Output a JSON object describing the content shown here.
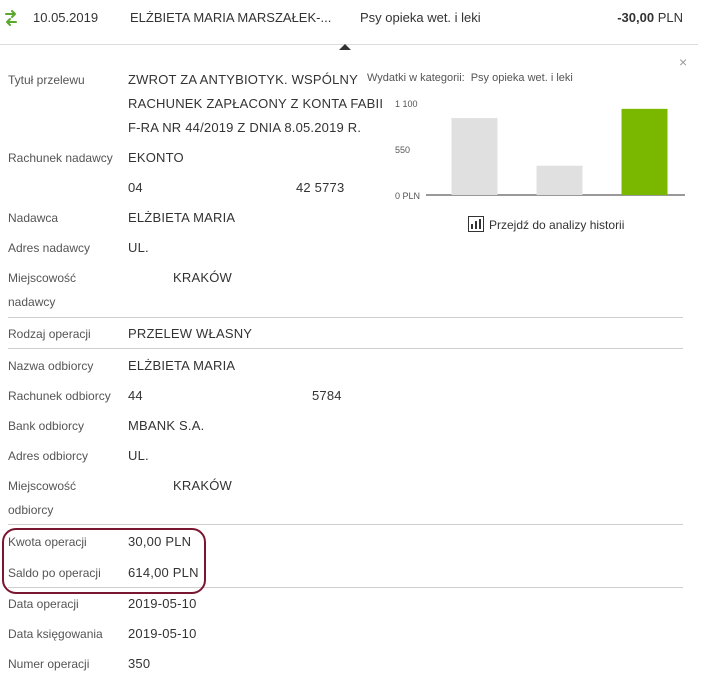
{
  "header": {
    "date": "10.05.2019",
    "payee": "ELŻBIETA MARIA MARSZAŁEK-...",
    "category": "Psy opieka wet. i leki",
    "amount": "-30,00",
    "currency": "PLN",
    "close": "×",
    "transfer_icon": "transfer-arrows-icon"
  },
  "details": {
    "title_label": "Tytuł przelewu",
    "title_lines": [
      "ZWROT ZA ANTYBIOTYK. WSPÓLNY",
      "RACHUNEK ZAPŁACONY Z KONTA FABII",
      "F-RA NR 44/2019 Z DNIA 8.05.2019 R."
    ],
    "sender_account_label": "Rachunek nadawcy",
    "sender_account_name": "EKONTO",
    "sender_account_number_start": "04",
    "sender_account_number_end": "42 5773",
    "sender_label": "Nadawca",
    "sender": "ELŻBIETA MARIA",
    "sender_address_label": "Adres nadawcy",
    "sender_address": "UL.",
    "sender_city_label_1": "Miejscowość",
    "sender_city_label_2": "nadawcy",
    "sender_city": "KRAKÓW",
    "operation_type_label": "Rodzaj operacji",
    "operation_type": "PRZELEW WŁASNY",
    "recipient_name_label": "Nazwa odbiorcy",
    "recipient_name": "ELŻBIETA MARIA",
    "recipient_account_label": "Rachunek odbiorcy",
    "recipient_account_start": "44",
    "recipient_account_end": "5784",
    "recipient_bank_label": "Bank odbiorcy",
    "recipient_bank": "MBANK S.A.",
    "recipient_address_label": "Adres odbiorcy",
    "recipient_address": "UL.",
    "recipient_city_label_1": "Miejscowość",
    "recipient_city_label_2": "odbiorcy",
    "recipient_city": "KRAKÓW",
    "amount_label": "Kwota operacji",
    "amount": "30,00 PLN",
    "balance_label": "Saldo po operacji",
    "balance": "614,00 PLN",
    "op_date_label": "Data operacji",
    "op_date": "2019-05-10",
    "booking_date_label": "Data księgowania",
    "booking_date": "2019-05-10",
    "op_number_label": "Numer operacji",
    "op_number": "350"
  },
  "chart_title_prefix": "Wydatki w kategorii:",
  "chart_title_category": "Psy opieka wet. i leki",
  "history_link": "Przejdź do analizy historii",
  "history_icon": "bar-chart-icon",
  "colors": {
    "bar_grey": "#e0e0e0",
    "bar_highlight": "#7ab800",
    "highlight_border": "#7a1730",
    "transfer_icon": "#5aa82c"
  },
  "chart_data": {
    "type": "bar",
    "title": "Wydatki w kategorii: Psy opieka wet. i leki",
    "categories": [
      "",
      "",
      ""
    ],
    "values": [
      920,
      350,
      1030
    ],
    "highlight_index": 2,
    "ylim": [
      0,
      1100
    ],
    "yticks": [
      0,
      550,
      1100
    ],
    "ytick_labels": [
      "0 PLN",
      "550",
      "1 100"
    ],
    "grid": false,
    "legend": "none"
  }
}
